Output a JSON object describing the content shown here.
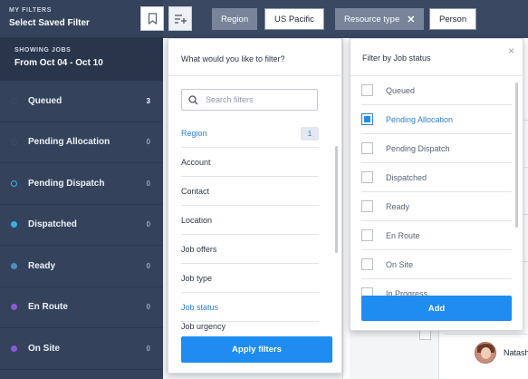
{
  "sidebar": {
    "my_filters_label": "MY FILTERS",
    "saved_filter_value": "Select Saved Filter",
    "showing_label": "SHOWING JOBS",
    "date_range": "From Oct 04 - Oct 10",
    "statuses": [
      {
        "label": "Queued",
        "count": "3",
        "color": "#3a4a6a"
      },
      {
        "label": "Pending Allocation",
        "count": "0",
        "color": "#3a4a6a"
      },
      {
        "label": "Pending Dispatch",
        "count": "0",
        "color": "#3ab0e8"
      },
      {
        "label": "Dispatched",
        "count": "0",
        "color": "#3ab0e8"
      },
      {
        "label": "Ready",
        "count": "0",
        "color": "#4f8fc0"
      },
      {
        "label": "En Route",
        "count": "0",
        "color": "#8a5ad8"
      },
      {
        "label": "On Site",
        "count": "0",
        "color": "#8a5ad8"
      }
    ]
  },
  "topbar": {
    "chips": [
      {
        "key": "Region",
        "value": "US Pacific"
      },
      {
        "key": "Resource type",
        "value": "Person"
      }
    ]
  },
  "filter_menu": {
    "title": "What would you like to filter?",
    "search_placeholder": "Search filters",
    "items": [
      {
        "label": "Region",
        "badge": "1",
        "active": true
      },
      {
        "label": "Account"
      },
      {
        "label": "Contact"
      },
      {
        "label": "Location"
      },
      {
        "label": "Job offers"
      },
      {
        "label": "Job type"
      },
      {
        "label": "Job status",
        "active": true
      },
      {
        "label": "Job urgency"
      }
    ],
    "apply_label": "Apply filters"
  },
  "status_filter": {
    "title": "Filter by Job status",
    "close_glyph": "×",
    "options": [
      {
        "label": "Queued",
        "checked": false
      },
      {
        "label": "Pending Allocation",
        "checked": true
      },
      {
        "label": "Pending Dispatch",
        "checked": false
      },
      {
        "label": "Dispatched",
        "checked": false
      },
      {
        "label": "Ready",
        "checked": false
      },
      {
        "label": "En Route",
        "checked": false
      },
      {
        "label": "On Site",
        "checked": false
      },
      {
        "label": "In Progress",
        "checked": false
      }
    ],
    "add_label": "Add"
  },
  "background": {
    "partial_name": "Natasha"
  },
  "colors": {
    "sidebar_bg": "#34425c",
    "accent_blue": "#1e8cf0",
    "link_blue": "#2f7fd6"
  }
}
